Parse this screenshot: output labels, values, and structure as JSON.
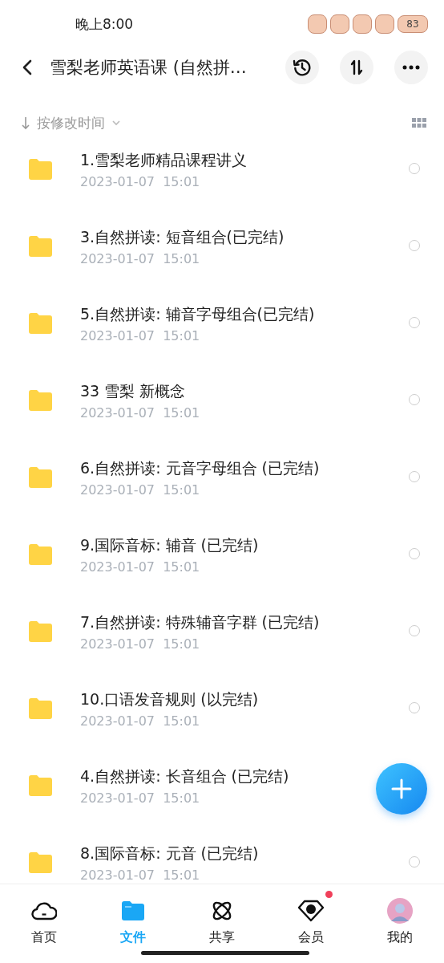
{
  "status_bar": {
    "time": "晚上8:00",
    "battery": "83"
  },
  "header": {
    "title": "雪梨老师英语课 (自然拼…"
  },
  "sort": {
    "label": "按修改时间"
  },
  "files": [
    {
      "name": "1.雪梨老师精品课程讲义",
      "date": "2023-01-07  15:01",
      "selected": false
    },
    {
      "name": "3.自然拼读: 短音组合(已完结)",
      "date": "2023-01-07  15:01",
      "selected": false
    },
    {
      "name": "5.自然拼读: 辅音字母组合(已完结)",
      "date": "2023-01-07  15:01",
      "selected": false
    },
    {
      "name": "33 雪梨 新概念",
      "date": "2023-01-07  15:01",
      "selected": false
    },
    {
      "name": "6.自然拼读: 元音字母组合 (已完结)",
      "date": "2023-01-07  15:01",
      "selected": false
    },
    {
      "name": "9.国际音标: 辅音 (已完结)",
      "date": "2023-01-07  15:01",
      "selected": false
    },
    {
      "name": "7.自然拼读: 特殊辅音字群 (已完结)",
      "date": "2023-01-07  15:01",
      "selected": false
    },
    {
      "name": "10.口语发音规则 (以完结)",
      "date": "2023-01-07  15:01",
      "selected": false
    },
    {
      "name": "4.自然拼读: 长音组合 (已完结)",
      "date": "2023-01-07  15:01"
    },
    {
      "name": "8.国际音标: 元音 (已完结)",
      "date": "2023-01-07  15:01",
      "selected": false
    }
  ],
  "nav": [
    {
      "label": "首页",
      "kind": "home",
      "selected": false
    },
    {
      "label": "文件",
      "kind": "files",
      "selected": true
    },
    {
      "label": "共享",
      "kind": "share",
      "selected": false
    },
    {
      "label": "会员",
      "kind": "vip",
      "selected": false,
      "badge": true
    },
    {
      "label": "我的",
      "kind": "me",
      "selected": false
    }
  ]
}
